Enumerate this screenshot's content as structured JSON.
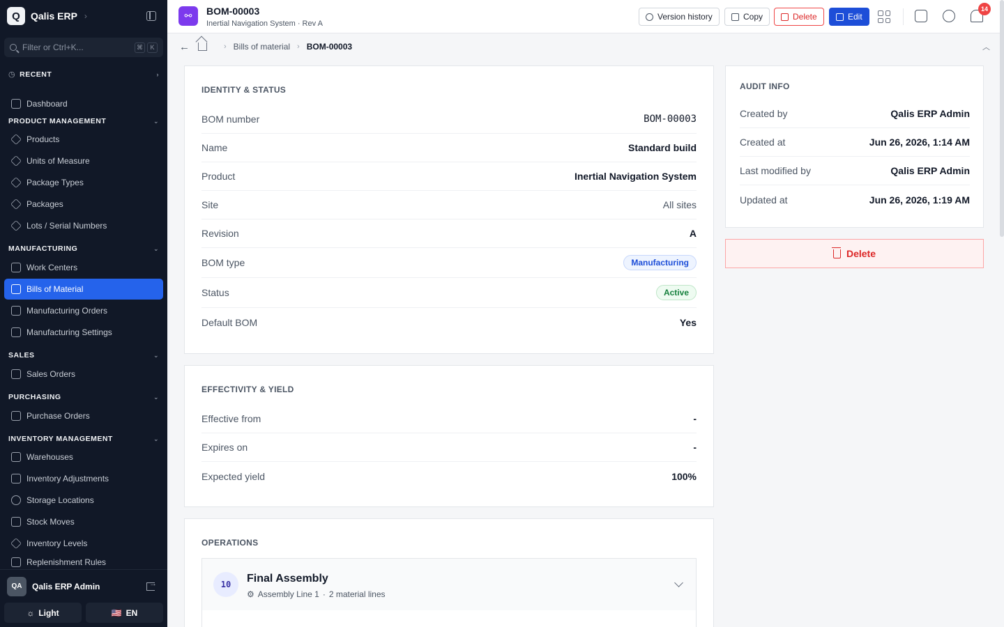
{
  "app": {
    "logo_letter": "Q",
    "name": "Qalis ERP",
    "filter_placeholder": "Filter or Ctrl+K...",
    "shortcut_keys": [
      "⌘",
      "K"
    ]
  },
  "sidebar": {
    "recent_label": "RECENT",
    "dashboard": "Dashboard",
    "sections": [
      {
        "title": "PRODUCT MANAGEMENT",
        "items": [
          "Products",
          "Units of Measure",
          "Package Types",
          "Packages",
          "Lots / Serial Numbers"
        ]
      },
      {
        "title": "MANUFACTURING",
        "items": [
          "Work Centers",
          "Bills of Material",
          "Manufacturing Orders",
          "Manufacturing Settings"
        ]
      },
      {
        "title": "SALES",
        "items": [
          "Sales Orders"
        ]
      },
      {
        "title": "PURCHASING",
        "items": [
          "Purchase Orders"
        ]
      },
      {
        "title": "INVENTORY MANAGEMENT",
        "items": [
          "Warehouses",
          "Inventory Adjustments",
          "Storage Locations",
          "Stock Moves",
          "Inventory Levels",
          "Replenishment Rules"
        ]
      }
    ],
    "active_item": "Bills of Material",
    "user": {
      "initials": "QA",
      "name": "Qalis ERP Admin"
    },
    "theme_label": "Light",
    "language_flag": "🇺🇸",
    "language_label": "EN"
  },
  "header": {
    "title": "BOM-00003",
    "subtitle": "Inertial Navigation System · Rev A",
    "buttons": {
      "version_history": "Version history",
      "copy": "Copy",
      "delete": "Delete",
      "edit": "Edit"
    },
    "notification_count": "14"
  },
  "breadcrumb": {
    "parent": "Bills of material",
    "current": "BOM-00003"
  },
  "identity": {
    "title": "IDENTITY & STATUS",
    "rows": [
      {
        "label": "BOM number",
        "value": "BOM-00003"
      },
      {
        "label": "Name",
        "value": "Standard build"
      },
      {
        "label": "Product",
        "value": "Inertial Navigation System"
      },
      {
        "label": "Site",
        "value": "All sites"
      },
      {
        "label": "Revision",
        "value": "A"
      },
      {
        "label": "BOM type",
        "value": "Manufacturing"
      },
      {
        "label": "Status",
        "value": "Active"
      },
      {
        "label": "Default BOM",
        "value": "Yes"
      }
    ]
  },
  "effectivity": {
    "title": "EFFECTIVITY & YIELD",
    "rows": [
      {
        "label": "Effective from",
        "value": "-"
      },
      {
        "label": "Expires on",
        "value": "-"
      },
      {
        "label": "Expected yield",
        "value": "100%"
      }
    ]
  },
  "operations": {
    "title": "OPERATIONS",
    "items": [
      {
        "seq": "10",
        "name": "Final Assembly",
        "work_center": "Assembly Line 1",
        "material_lines": "2 material lines"
      }
    ]
  },
  "audit": {
    "title": "AUDIT INFO",
    "rows": [
      {
        "label": "Created by",
        "value": "Qalis ERP Admin"
      },
      {
        "label": "Created at",
        "value": "Jun 26, 2026, 1:14 AM"
      },
      {
        "label": "Last modified by",
        "value": "Qalis ERP Admin"
      },
      {
        "label": "Updated at",
        "value": "Jun 26, 2026, 1:19 AM"
      }
    ],
    "delete_label": "Delete"
  },
  "colors": {
    "sidebar_bg": "#111827",
    "accent": "#2563eb",
    "danger": "#dc2626",
    "bom_icon": "#7c3aed"
  }
}
